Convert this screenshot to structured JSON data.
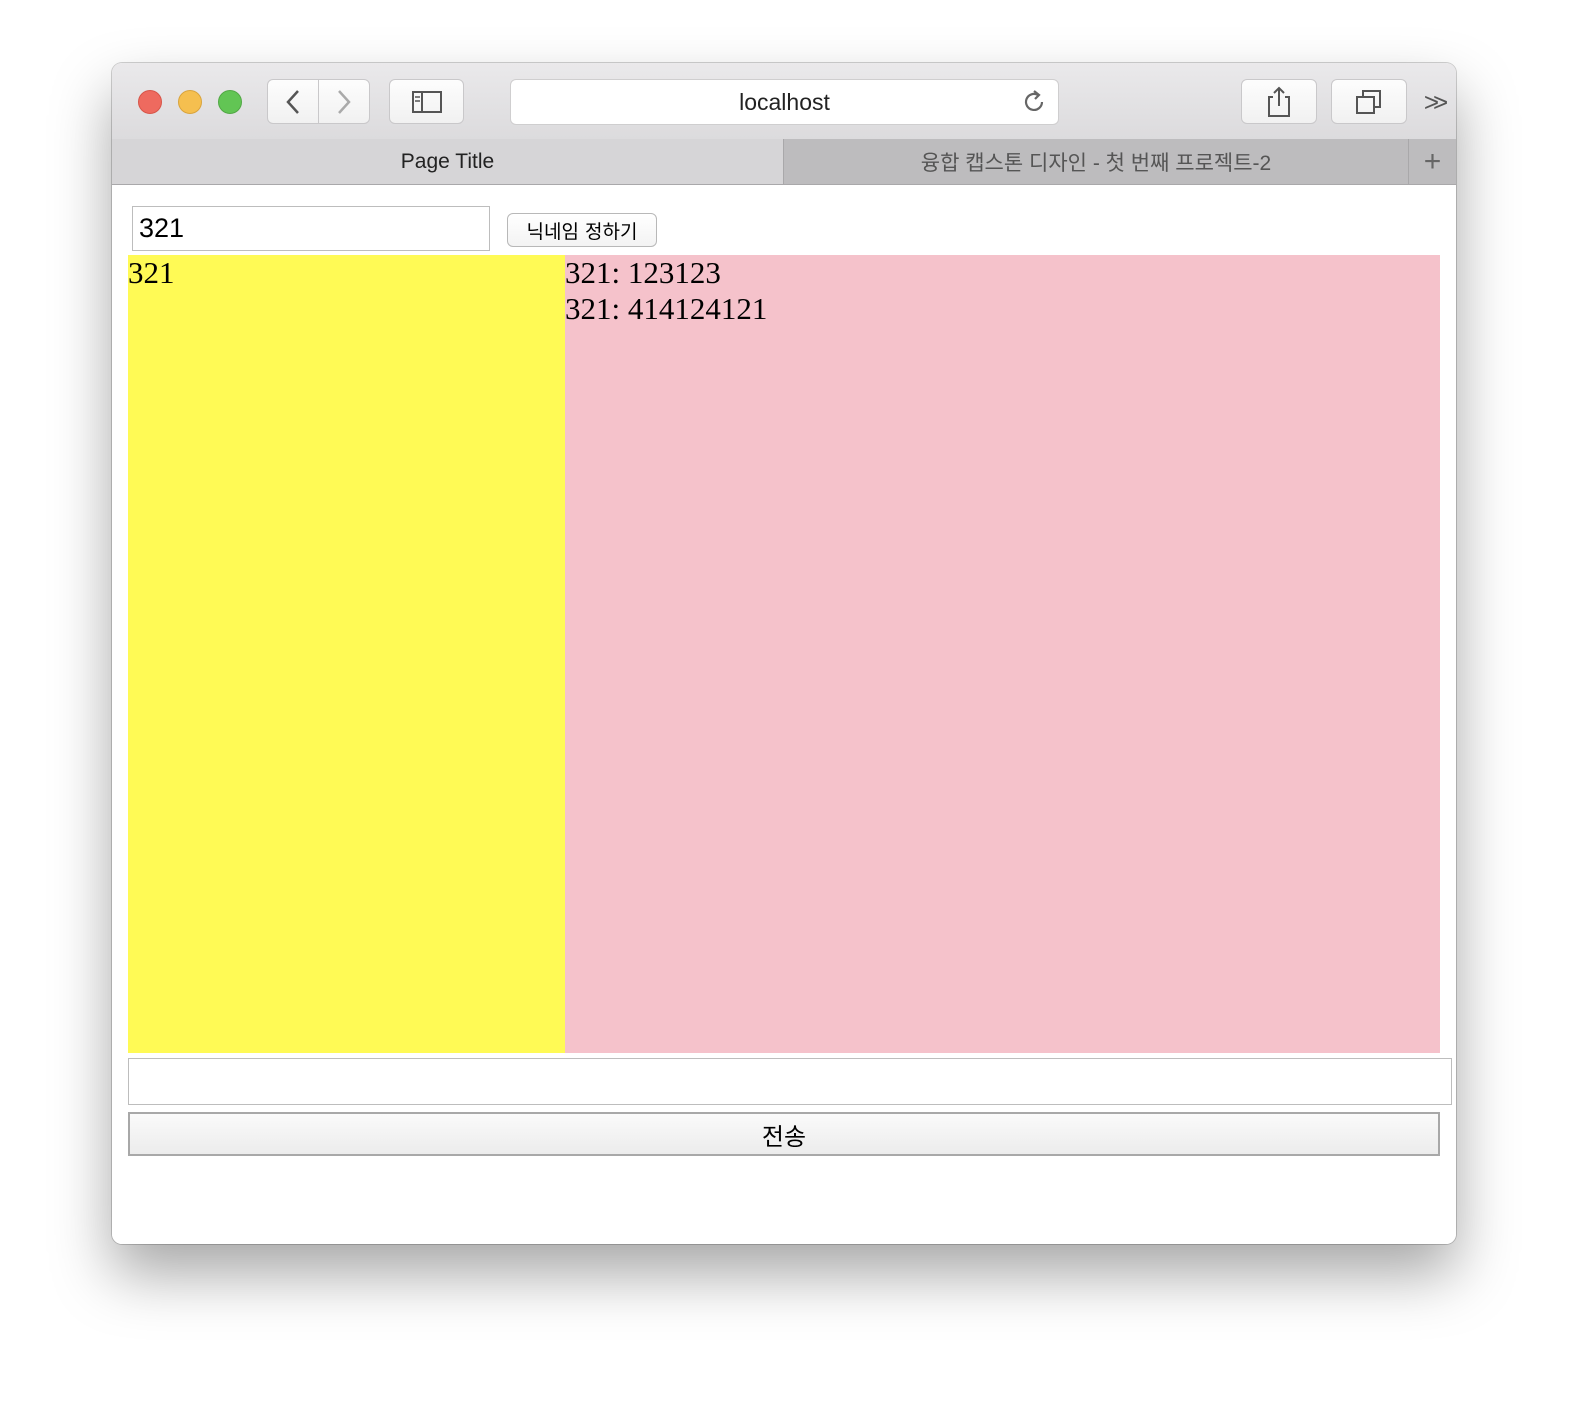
{
  "browser": {
    "url": "localhost",
    "tabs": [
      {
        "label": "Page Title",
        "active": true
      },
      {
        "label": "융합 캡스톤 디자인 - 첫 번째 프로젝트-2",
        "active": false
      }
    ],
    "new_tab_symbol": "+",
    "more_symbol": ">>"
  },
  "nickname": {
    "input_value": "321",
    "button_label": "닉네임 정하기"
  },
  "users_panel": {
    "background": "#fffa55",
    "users": [
      "321"
    ]
  },
  "messages_panel": {
    "background": "#f5c2cb",
    "messages": [
      "321: 123123",
      "321: 414124121"
    ]
  },
  "composer": {
    "input_value": "",
    "send_label": "전송"
  }
}
